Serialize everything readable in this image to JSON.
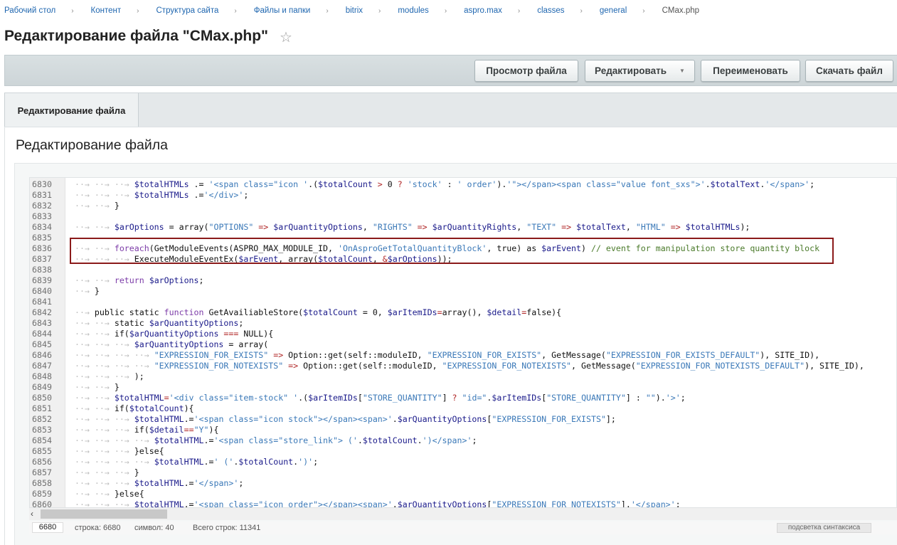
{
  "breadcrumb": [
    "Рабочий стол",
    "Контент",
    "Структура сайта",
    "Файлы и папки",
    "bitrix",
    "modules",
    "aspro.max",
    "classes",
    "general",
    "CMax.php"
  ],
  "page_title": "Редактирование файла \"CMax.php\"",
  "toolbar": {
    "view_label": "Просмотр файла",
    "edit_label": "Редактировать",
    "rename_label": "Переименовать",
    "download_label": "Скачать файл"
  },
  "tab_label": "Редактирование файла",
  "section_title": "Редактирование файла",
  "code_lines": [
    {
      "n": "6830",
      "i": 3,
      "t": [
        [
          "v",
          "$totalHTMLs"
        ],
        [
          "p",
          " .= "
        ],
        [
          "s",
          "'<span class=\"icon '"
        ],
        [
          "p",
          "."
        ],
        [
          "p",
          "("
        ],
        [
          "v",
          "$totalCount"
        ],
        [
          "o",
          " > "
        ],
        [
          "p",
          "0 "
        ],
        [
          "o",
          "? "
        ],
        [
          "s",
          "'stock'"
        ],
        [
          "p",
          " : "
        ],
        [
          "s",
          "' order'"
        ],
        [
          "p",
          ")."
        ],
        [
          "s",
          "'\"></span><span class=\"value font_sxs\">'"
        ],
        [
          "p",
          "."
        ],
        [
          "v",
          "$totalText"
        ],
        [
          "p",
          "."
        ],
        [
          "s",
          "'</span>'"
        ],
        [
          "p",
          ";"
        ]
      ]
    },
    {
      "n": "6831",
      "i": 3,
      "t": [
        [
          "v",
          "$totalHTMLs"
        ],
        [
          "p",
          " .="
        ],
        [
          "s",
          "'</div>'"
        ],
        [
          "p",
          ";"
        ]
      ]
    },
    {
      "n": "6832",
      "i": 2,
      "t": [
        [
          "p",
          "}"
        ]
      ]
    },
    {
      "n": "6833",
      "i": 0,
      "t": []
    },
    {
      "n": "6834",
      "i": 2,
      "t": [
        [
          "v",
          "$arOptions"
        ],
        [
          "p",
          " = "
        ],
        [
          "p",
          "array("
        ],
        [
          "s",
          "\"OPTIONS\""
        ],
        [
          "o",
          " => "
        ],
        [
          "v",
          "$arQuantityOptions"
        ],
        [
          "p",
          ", "
        ],
        [
          "s",
          "\"RIGHTS\""
        ],
        [
          "o",
          " => "
        ],
        [
          "v",
          "$arQuantityRights"
        ],
        [
          "p",
          ", "
        ],
        [
          "s",
          "\"TEXT\""
        ],
        [
          "o",
          " => "
        ],
        [
          "v",
          "$totalText"
        ],
        [
          "p",
          ", "
        ],
        [
          "s",
          "\"HTML\""
        ],
        [
          "o",
          " => "
        ],
        [
          "v",
          "$totalHTMLs"
        ],
        [
          "p",
          ");"
        ]
      ]
    },
    {
      "n": "6835",
      "i": 0,
      "t": []
    },
    {
      "n": "6836",
      "i": 2,
      "t": [
        [
          "k",
          "foreach"
        ],
        [
          "p",
          "(GetModuleEvents(ASPRO_MAX_MODULE_ID, "
        ],
        [
          "s",
          "'OnAsproGetTotalQuantityBlock'"
        ],
        [
          "p",
          ", true) as "
        ],
        [
          "v",
          "$arEvent"
        ],
        [
          "p",
          ") "
        ],
        [
          "c",
          "// event for manipulation store quantity block"
        ]
      ]
    },
    {
      "n": "6837",
      "i": 3,
      "t": [
        [
          "p",
          "ExecuteModuleEventEx("
        ],
        [
          "v",
          "$arEvent"
        ],
        [
          "p",
          ", array("
        ],
        [
          "v",
          "$totalCount"
        ],
        [
          "p",
          ", "
        ],
        [
          "o",
          "&"
        ],
        [
          "v",
          "$arOptions"
        ],
        [
          "p",
          "));"
        ]
      ]
    },
    {
      "n": "6838",
      "i": 0,
      "t": []
    },
    {
      "n": "6839",
      "i": 2,
      "t": [
        [
          "k",
          "return "
        ],
        [
          "v",
          "$arOptions"
        ],
        [
          "p",
          ";"
        ]
      ]
    },
    {
      "n": "6840",
      "i": 1,
      "t": [
        [
          "p",
          "}"
        ]
      ]
    },
    {
      "n": "6841",
      "i": 0,
      "t": []
    },
    {
      "n": "6842",
      "i": 1,
      "t": [
        [
          "p",
          "public static "
        ],
        [
          "k",
          "function "
        ],
        [
          "p",
          "GetAvailiableStore("
        ],
        [
          "v",
          "$totalCount"
        ],
        [
          "p",
          " = 0, "
        ],
        [
          "v",
          "$arItemIDs"
        ],
        [
          "o",
          "="
        ],
        [
          "p",
          "array(), "
        ],
        [
          "v",
          "$detail"
        ],
        [
          "o",
          "="
        ],
        [
          "p",
          "false){"
        ]
      ]
    },
    {
      "n": "6843",
      "i": 2,
      "t": [
        [
          "p",
          "static "
        ],
        [
          "v",
          "$arQuantityOptions"
        ],
        [
          "p",
          ";"
        ]
      ]
    },
    {
      "n": "6844",
      "i": 2,
      "t": [
        [
          "p",
          "if("
        ],
        [
          "v",
          "$arQuantityOptions"
        ],
        [
          "o",
          " === "
        ],
        [
          "p",
          "NULL){"
        ]
      ]
    },
    {
      "n": "6845",
      "i": 3,
      "t": [
        [
          "v",
          "$arQuantityOptions"
        ],
        [
          "p",
          " = "
        ],
        [
          "p",
          "array("
        ]
      ]
    },
    {
      "n": "6846",
      "i": 4,
      "t": [
        [
          "s",
          "\"EXPRESSION_FOR_EXISTS\""
        ],
        [
          "o",
          " => "
        ],
        [
          "p",
          "Option::get(self::moduleID, "
        ],
        [
          "s",
          "\"EXPRESSION_FOR_EXISTS\""
        ],
        [
          "p",
          ", GetMessage("
        ],
        [
          "s",
          "\"EXPRESSION_FOR_EXISTS_DEFAULT\""
        ],
        [
          "p",
          "), SITE_ID),"
        ]
      ]
    },
    {
      "n": "6847",
      "i": 4,
      "t": [
        [
          "s",
          "\"EXPRESSION_FOR_NOTEXISTS\""
        ],
        [
          "o",
          " => "
        ],
        [
          "p",
          "Option::get(self::moduleID, "
        ],
        [
          "s",
          "\"EXPRESSION_FOR_NOTEXISTS\""
        ],
        [
          "p",
          ", GetMessage("
        ],
        [
          "s",
          "\"EXPRESSION_FOR_NOTEXISTS_DEFAULT\""
        ],
        [
          "p",
          "), SITE_ID),"
        ]
      ]
    },
    {
      "n": "6848",
      "i": 3,
      "t": [
        [
          "p",
          ");"
        ]
      ]
    },
    {
      "n": "6849",
      "i": 2,
      "t": [
        [
          "p",
          "}"
        ]
      ]
    },
    {
      "n": "6850",
      "i": 2,
      "t": [
        [
          "v",
          "$totalHTML"
        ],
        [
          "o",
          "="
        ],
        [
          "s",
          "'<div class=\"item-stock\" '"
        ],
        [
          "p",
          ".("
        ],
        [
          "v",
          "$arItemIDs"
        ],
        [
          "p",
          "["
        ],
        [
          "s",
          "\"STORE_QUANTITY\""
        ],
        [
          "p",
          "] "
        ],
        [
          "o",
          "? "
        ],
        [
          "s",
          "\"id=\""
        ],
        [
          "p",
          "."
        ],
        [
          "v",
          "$arItemIDs"
        ],
        [
          "p",
          "["
        ],
        [
          "s",
          "\"STORE_QUANTITY\""
        ],
        [
          "p",
          "] : "
        ],
        [
          "s",
          "\"\""
        ],
        [
          "p",
          ")."
        ],
        [
          "s",
          "'>'"
        ],
        [
          "p",
          ";"
        ]
      ]
    },
    {
      "n": "6851",
      "i": 2,
      "t": [
        [
          "p",
          "if("
        ],
        [
          "v",
          "$totalCount"
        ],
        [
          "p",
          "){"
        ]
      ]
    },
    {
      "n": "6852",
      "i": 3,
      "t": [
        [
          "v",
          "$totalHTML"
        ],
        [
          "p",
          ".="
        ],
        [
          "s",
          "'<span class=\"icon stock\"></span><span>'"
        ],
        [
          "p",
          "."
        ],
        [
          "v",
          "$arQuantityOptions"
        ],
        [
          "p",
          "["
        ],
        [
          "s",
          "\"EXPRESSION_FOR_EXISTS\""
        ],
        [
          "p",
          "];"
        ]
      ]
    },
    {
      "n": "6853",
      "i": 3,
      "t": [
        [
          "p",
          "if("
        ],
        [
          "v",
          "$detail"
        ],
        [
          "o",
          "=="
        ],
        [
          "s",
          "\"Y\""
        ],
        [
          "p",
          "){"
        ]
      ]
    },
    {
      "n": "6854",
      "i": 4,
      "t": [
        [
          "v",
          "$totalHTML"
        ],
        [
          "p",
          ".="
        ],
        [
          "s",
          "'<span class=\"store_link\"> ('"
        ],
        [
          "p",
          "."
        ],
        [
          "v",
          "$totalCount"
        ],
        [
          "p",
          "."
        ],
        [
          "s",
          "')</span>'"
        ],
        [
          "p",
          ";"
        ]
      ]
    },
    {
      "n": "6855",
      "i": 3,
      "t": [
        [
          "p",
          "}else{"
        ]
      ]
    },
    {
      "n": "6856",
      "i": 4,
      "t": [
        [
          "v",
          "$totalHTML"
        ],
        [
          "p",
          ".="
        ],
        [
          "s",
          "' ('"
        ],
        [
          "p",
          "."
        ],
        [
          "v",
          "$totalCount"
        ],
        [
          "p",
          "."
        ],
        [
          "s",
          "')'"
        ],
        [
          "p",
          ";"
        ]
      ]
    },
    {
      "n": "6857",
      "i": 3,
      "t": [
        [
          "p",
          "}"
        ]
      ]
    },
    {
      "n": "6858",
      "i": 3,
      "t": [
        [
          "v",
          "$totalHTML"
        ],
        [
          "p",
          ".="
        ],
        [
          "s",
          "'</span>'"
        ],
        [
          "p",
          ";"
        ]
      ]
    },
    {
      "n": "6859",
      "i": 2,
      "t": [
        [
          "p",
          "}else{"
        ]
      ]
    },
    {
      "n": "6860",
      "i": 3,
      "t": [
        [
          "v",
          "$totalHTML"
        ],
        [
          "p",
          ".="
        ],
        [
          "s",
          "'<span class=\"icon order\"></span><span>'"
        ],
        [
          "p",
          "."
        ],
        [
          "v",
          "$arQuantityOptions"
        ],
        [
          "p",
          "["
        ],
        [
          "s",
          "\"EXPRESSION_FOR_NOTEXISTS\""
        ],
        [
          "p",
          "]."
        ],
        [
          "s",
          "'</span>'"
        ],
        [
          "p",
          ";"
        ]
      ]
    }
  ],
  "status": {
    "current_line": "6680",
    "line_text": "строка: 6680",
    "symbol_text": "символ: 40",
    "total_text": "Всего строк: 11341",
    "syntax_label": "подсветка синтаксиса"
  },
  "colors": {
    "link": "#2067b0",
    "highlight_border": "#8b1a1a",
    "string": "#3b79b8",
    "variable": "#1a1a8a"
  }
}
